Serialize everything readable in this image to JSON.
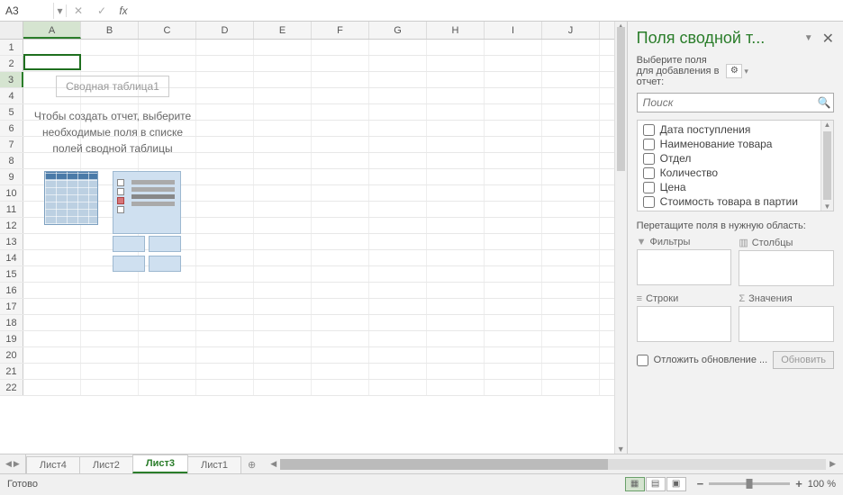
{
  "formula_bar": {
    "cell_ref": "A3",
    "formula": ""
  },
  "columns": [
    "A",
    "B",
    "C",
    "D",
    "E",
    "F",
    "G",
    "H",
    "I",
    "J"
  ],
  "rows": [
    "1",
    "2",
    "3",
    "4",
    "5",
    "6",
    "7",
    "8",
    "9",
    "10",
    "11",
    "12",
    "13",
    "14",
    "15",
    "16",
    "17",
    "18",
    "19",
    "20",
    "21",
    "22"
  ],
  "active_col": "A",
  "active_row": "3",
  "pivot_placeholder": {
    "title": "Сводная таблица1",
    "help": "Чтобы создать отчет, выберите необходимые поля в списке полей сводной таблицы"
  },
  "task_pane": {
    "title": "Поля сводной т...",
    "subtitle": "Выберите поля для добавления в отчет:",
    "search_placeholder": "Поиск",
    "fields": [
      "Дата поступления",
      "Наименование товара",
      "Отдел",
      "Количество",
      "Цена",
      "Стоимость товара в партии"
    ],
    "drag_label": "Перетащите поля в нужную область:",
    "zones": {
      "filters": "Фильтры",
      "columns": "Столбцы",
      "rows": "Строки",
      "values": "Значения"
    },
    "defer_label": "Отложить обновление ...",
    "update_label": "Обновить"
  },
  "sheets": {
    "tabs": [
      "Лист4",
      "Лист2",
      "Лист3",
      "Лист1"
    ],
    "active": "Лист3",
    "new_symbol": "⊕"
  },
  "status_bar": {
    "ready": "Готово",
    "zoom_label": "100 %"
  }
}
